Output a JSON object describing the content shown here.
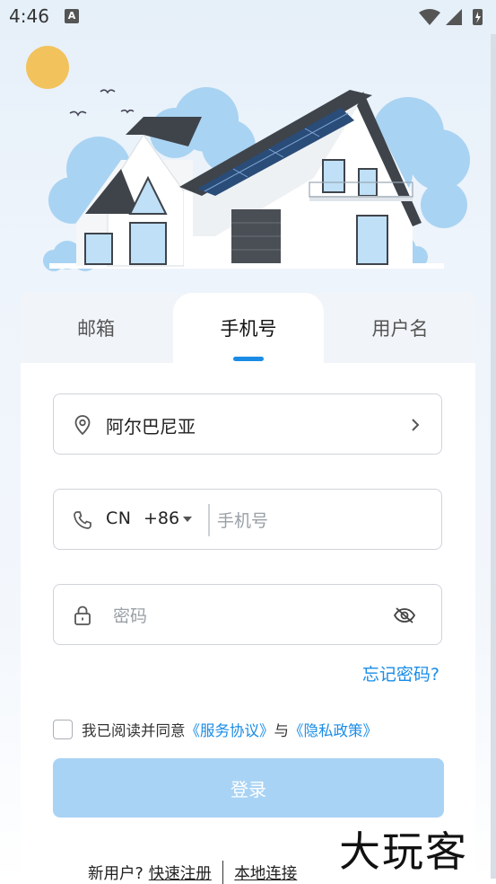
{
  "status_bar": {
    "time": "4:46",
    "notif_glyph": "A"
  },
  "tabs": [
    {
      "label": "邮箱",
      "active": false
    },
    {
      "label": "手机号",
      "active": true
    },
    {
      "label": "用户名",
      "active": false
    }
  ],
  "form": {
    "region": {
      "value": "阿尔巴尼亚",
      "icon": "location-pin-icon"
    },
    "phone": {
      "country_code": "CN",
      "dial_code": "+86",
      "placeholder": "手机号",
      "icon": "phone-icon"
    },
    "password": {
      "placeholder": "密码",
      "icon": "lock-icon",
      "toggle_icon": "eye-hidden-icon"
    },
    "forgot_password": "忘记密码?",
    "agreement": {
      "prefix": "我已阅读并同意",
      "terms": "《服务协议》",
      "conjunction": "与",
      "privacy": "《隐私政策》",
      "checked": false
    },
    "login_label": "登录"
  },
  "footer": {
    "new_user": "新用户?",
    "register": "快速注册",
    "local_connect": "本地连接"
  },
  "watermark": "大玩客",
  "colors": {
    "accent": "#1a8ce6",
    "button_disabled": "#a9d3f5",
    "tab_bg": "#f1f4f8"
  }
}
